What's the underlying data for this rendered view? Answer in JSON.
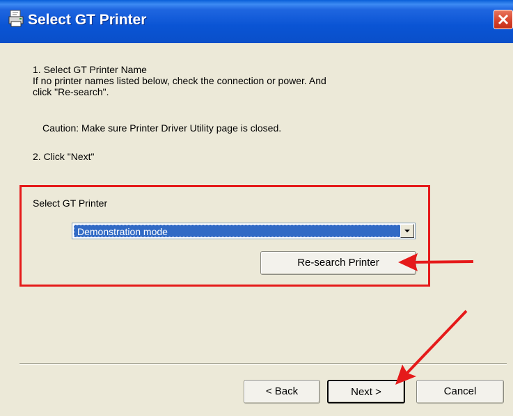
{
  "window": {
    "title": "Select GT Printer",
    "icons": {
      "app": "printer-icon",
      "close": "close-icon"
    },
    "accent_color": "#0a54d4"
  },
  "instructions": {
    "step1_title": "1. Select GT Printer Name",
    "step1_line1": "If no printer names listed below, check the connection or power. And",
    "step1_line2": "click \"Re-search\".",
    "caution": "Caution: Make sure Printer Driver Utility page is closed.",
    "step2": "2. Click \"Next\""
  },
  "group": {
    "label": "Select GT Printer",
    "highlight_color": "#e51a1a",
    "dropdown": {
      "selected": "Demonstration mode"
    },
    "research_button": "Re-search Printer"
  },
  "footer": {
    "back_label": "< Back",
    "next_label": "Next >",
    "cancel_label": "Cancel"
  },
  "annotations": {
    "arrow_color": "#e51a1a"
  }
}
